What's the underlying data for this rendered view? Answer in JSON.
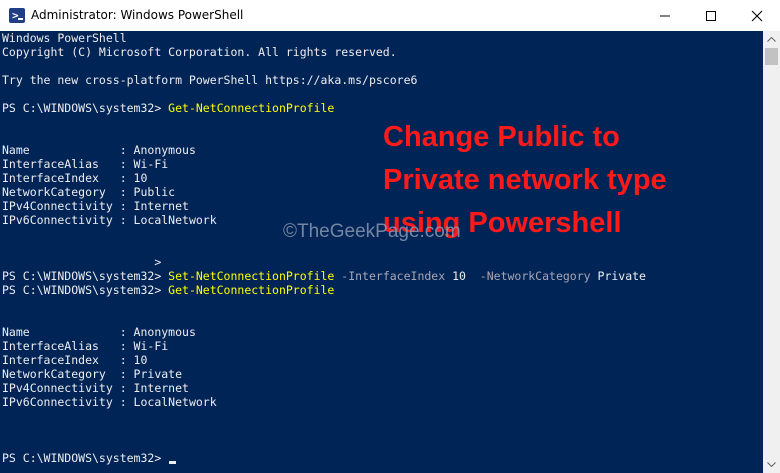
{
  "window": {
    "title": "Administrator: Windows PowerShell",
    "icon": "powershell-icon"
  },
  "colors": {
    "console_bg": "#012456",
    "text": "#eeedf0",
    "command": "#ffff00",
    "parameter": "#a7a7b5",
    "overlay_text": "#ff1a1a"
  },
  "console": {
    "header": {
      "line1": "Windows PowerShell",
      "line2": "Copyright (C) Microsoft Corporation. All rights reserved.",
      "line3": "Try the new cross-platform PowerShell https://aka.ms/pscore6"
    },
    "prompt": "PS C:\\WINDOWS\\system32> ",
    "cmd1": "Get-NetConnectionProfile",
    "result1": [
      {
        "key": "Name             ",
        "value": ": Anonymous"
      },
      {
        "key": "InterfaceAlias   ",
        "value": ": Wi-Fi"
      },
      {
        "key": "InterfaceIndex   ",
        "value": ": 10"
      },
      {
        "key": "NetworkCategory  ",
        "value": ": Public"
      },
      {
        "key": "IPv4Connectivity ",
        "value": ": Internet"
      },
      {
        "key": "IPv6Connectivity ",
        "value": ": LocalNetwork"
      }
    ],
    "continuation": "                      >",
    "cmd2": {
      "name": "Set-NetConnectionProfile",
      "param1": "-InterfaceIndex",
      "value1": "10",
      "param2": "-NetworkCategory",
      "value2": "Private"
    },
    "cmd3": "Get-NetConnectionProfile",
    "result2": [
      {
        "key": "Name             ",
        "value": ": Anonymous"
      },
      {
        "key": "InterfaceAlias   ",
        "value": ": Wi-Fi"
      },
      {
        "key": "InterfaceIndex   ",
        "value": ": 10"
      },
      {
        "key": "NetworkCategory  ",
        "value": ": Private"
      },
      {
        "key": "IPv4Connectivity ",
        "value": ": Internet"
      },
      {
        "key": "IPv6Connectivity ",
        "value": ": LocalNetwork"
      }
    ]
  },
  "overlay": {
    "line1": "Change Public to",
    "line2": "Private network type",
    "line3": "using Powershell"
  },
  "watermark": "©TheGeekPage.com"
}
